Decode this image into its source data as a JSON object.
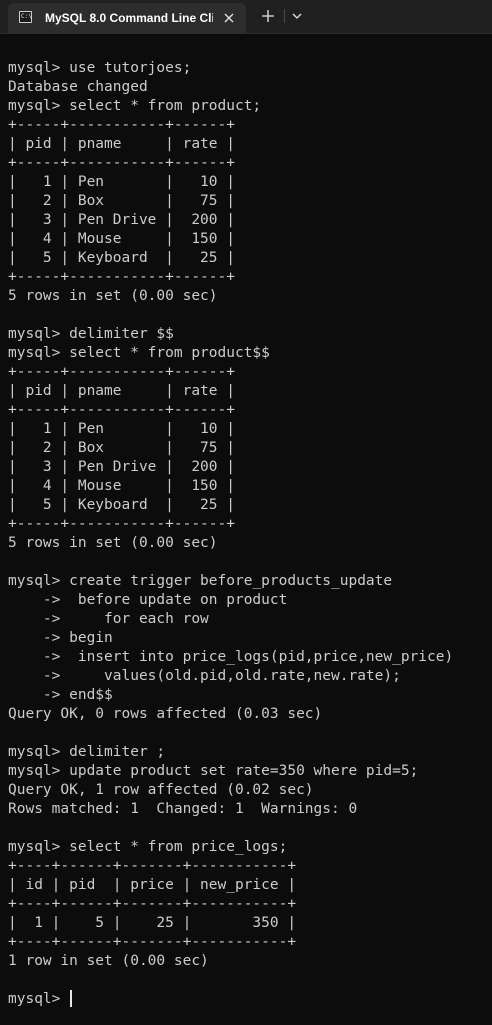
{
  "window": {
    "tab_title": "MySQL 8.0 Command Line Cli",
    "tab_icon_text": "C:\\"
  },
  "icons": {
    "close": "close-icon",
    "new_tab": "plus-icon",
    "dropdown": "chevron-down-icon",
    "app": "console-icon"
  },
  "terminal": {
    "lines": [
      "",
      "mysql> use tutorjoes;",
      "Database changed",
      "mysql> select * from product;",
      "+-----+-----------+------+",
      "| pid | pname     | rate |",
      "+-----+-----------+------+",
      "|   1 | Pen       |   10 |",
      "|   2 | Box       |   75 |",
      "|   3 | Pen Drive |  200 |",
      "|   4 | Mouse     |  150 |",
      "|   5 | Keyboard  |   25 |",
      "+-----+-----------+------+",
      "5 rows in set (0.00 sec)",
      "",
      "mysql> delimiter $$",
      "mysql> select * from product$$",
      "+-----+-----------+------+",
      "| pid | pname     | rate |",
      "+-----+-----------+------+",
      "|   1 | Pen       |   10 |",
      "|   2 | Box       |   75 |",
      "|   3 | Pen Drive |  200 |",
      "|   4 | Mouse     |  150 |",
      "|   5 | Keyboard  |   25 |",
      "+-----+-----------+------+",
      "5 rows in set (0.00 sec)",
      "",
      "mysql> create trigger before_products_update",
      "    ->  before update on product",
      "    ->     for each row",
      "    -> begin",
      "    ->  insert into price_logs(pid,price,new_price)",
      "    ->     values(old.pid,old.rate,new.rate);",
      "    -> end$$",
      "Query OK, 0 rows affected (0.03 sec)",
      "",
      "mysql> delimiter ;",
      "mysql> update product set rate=350 where pid=5;",
      "Query OK, 1 row affected (0.02 sec)",
      "Rows matched: 1  Changed: 1  Warnings: 0",
      "",
      "mysql> select * from price_logs;",
      "+----+------+-------+-----------+",
      "| id | pid  | price | new_price |",
      "+----+------+-------+-----------+",
      "|  1 |    5 |    25 |       350 |",
      "+----+------+-------+-----------+",
      "1 row in set (0.00 sec)",
      "",
      "mysql> "
    ]
  },
  "colors": {
    "background": "#0c0c0c",
    "text": "#cccccc",
    "tabbar": "#202020",
    "tab_active": "#2d2d2d"
  }
}
